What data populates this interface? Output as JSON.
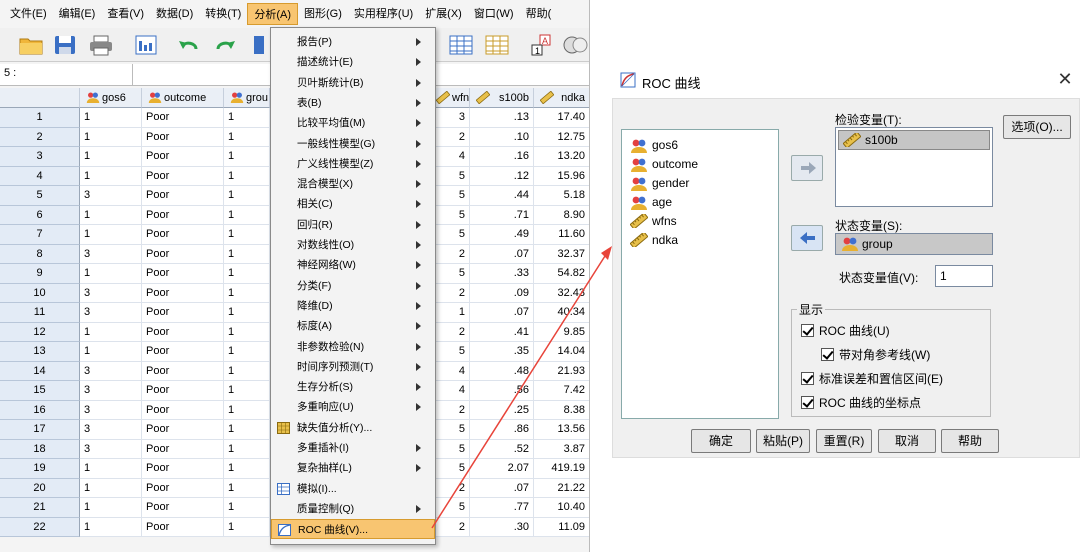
{
  "menubar": [
    "文件(E)",
    "编辑(E)",
    "查看(V)",
    "数据(D)",
    "转换(T)",
    "分析(A)",
    "图形(G)",
    "实用程序(U)",
    "扩展(X)",
    "窗口(W)",
    "帮助("
  ],
  "cellbar": {
    "ref": "5 :"
  },
  "grid": {
    "headers": [
      "gos6",
      "outcome",
      "grou",
      "wfns",
      "s100b",
      "ndka"
    ],
    "rows": [
      [
        "1",
        "1",
        "Poor",
        "1",
        "3",
        ".13",
        "17.40"
      ],
      [
        "2",
        "1",
        "Poor",
        "1",
        "2",
        ".10",
        "12.75"
      ],
      [
        "3",
        "1",
        "Poor",
        "1",
        "4",
        ".16",
        "13.20"
      ],
      [
        "4",
        "1",
        "Poor",
        "1",
        "5",
        ".12",
        "15.96"
      ],
      [
        "5",
        "3",
        "Poor",
        "1",
        "5",
        ".44",
        "5.18"
      ],
      [
        "6",
        "1",
        "Poor",
        "1",
        "5",
        ".71",
        "8.90"
      ],
      [
        "7",
        "1",
        "Poor",
        "1",
        "5",
        ".49",
        "11.60"
      ],
      [
        "8",
        "3",
        "Poor",
        "1",
        "2",
        ".07",
        "32.37"
      ],
      [
        "9",
        "1",
        "Poor",
        "1",
        "5",
        ".33",
        "54.82"
      ],
      [
        "10",
        "3",
        "Poor",
        "1",
        "2",
        ".09",
        "32.43"
      ],
      [
        "11",
        "3",
        "Poor",
        "1",
        "1",
        ".07",
        "40.34"
      ],
      [
        "12",
        "1",
        "Poor",
        "1",
        "2",
        ".41",
        "9.85"
      ],
      [
        "13",
        "1",
        "Poor",
        "1",
        "5",
        ".35",
        "14.04"
      ],
      [
        "14",
        "3",
        "Poor",
        "1",
        "4",
        ".48",
        "21.93"
      ],
      [
        "15",
        "3",
        "Poor",
        "1",
        "4",
        ".56",
        "7.42"
      ],
      [
        "16",
        "3",
        "Poor",
        "1",
        "2",
        ".25",
        "8.38"
      ],
      [
        "17",
        "3",
        "Poor",
        "1",
        "5",
        ".86",
        "13.56"
      ],
      [
        "18",
        "3",
        "Poor",
        "1",
        "5",
        ".52",
        "3.87"
      ],
      [
        "19",
        "1",
        "Poor",
        "1",
        "5",
        "2.07",
        "419.19"
      ],
      [
        "20",
        "1",
        "Poor",
        "1",
        "2",
        ".07",
        "21.22"
      ],
      [
        "21",
        "1",
        "Poor",
        "1",
        "5",
        ".77",
        "10.40"
      ],
      [
        "22",
        "1",
        "Poor",
        "1",
        "2",
        ".30",
        "11.09"
      ]
    ]
  },
  "menu": {
    "items": [
      {
        "label": "报告(P)",
        "sub": true
      },
      {
        "label": "描述统计(E)",
        "sub": true
      },
      {
        "label": "贝叶斯统计(B)",
        "sub": true
      },
      {
        "label": "表(B)",
        "sub": true
      },
      {
        "label": "比较平均值(M)",
        "sub": true
      },
      {
        "label": "一般线性模型(G)",
        "sub": true
      },
      {
        "label": "广义线性模型(Z)",
        "sub": true
      },
      {
        "label": "混合模型(X)",
        "sub": true
      },
      {
        "label": "相关(C)",
        "sub": true
      },
      {
        "label": "回归(R)",
        "sub": true
      },
      {
        "label": "对数线性(O)",
        "sub": true
      },
      {
        "label": "神经网络(W)",
        "sub": true
      },
      {
        "label": "分类(F)",
        "sub": true
      },
      {
        "label": "降维(D)",
        "sub": true
      },
      {
        "label": "标度(A)",
        "sub": true
      },
      {
        "label": "非参数检验(N)",
        "sub": true
      },
      {
        "label": "时间序列预测(T)",
        "sub": true
      },
      {
        "label": "生存分析(S)",
        "sub": true
      },
      {
        "label": "多重响应(U)",
        "sub": true
      },
      {
        "label": "缺失值分析(Y)...",
        "sub": false,
        "icon": "missing-value-icon"
      },
      {
        "label": "多重插补(I)",
        "sub": true
      },
      {
        "label": "复杂抽样(L)",
        "sub": true
      },
      {
        "label": "模拟(I)...",
        "sub": false,
        "icon": "simulation-icon"
      },
      {
        "label": "质量控制(Q)",
        "sub": true
      },
      {
        "label": "ROC 曲线(V)...",
        "sub": false,
        "icon": "roc-curve-icon",
        "highlight": true
      }
    ]
  },
  "dialog": {
    "title": "ROC 曲线",
    "close": "✕",
    "source_vars": [
      {
        "name": "gos6",
        "type": "nominal"
      },
      {
        "name": "outcome",
        "type": "nominal"
      },
      {
        "name": "gender",
        "type": "nominal"
      },
      {
        "name": "age",
        "type": "nominal"
      },
      {
        "name": "wfns",
        "type": "scale"
      },
      {
        "name": "ndka",
        "type": "scale"
      }
    ],
    "test_var_label": "检验变量(T):",
    "test_var": "s100b",
    "state_var_label": "状态变量(S):",
    "state_var": "group",
    "state_value_label": "状态变量值(V):",
    "state_value": "1",
    "options_btn": "选项(O)...",
    "display_label": "显示",
    "checks": [
      "ROC 曲线(U)",
      "带对角参考线(W)",
      "标准误差和置信区间(E)",
      "ROC 曲线的坐标点"
    ],
    "buttons": [
      "确定",
      "粘贴(P)",
      "重置(R)",
      "取消",
      "帮助"
    ],
    "colors": {
      "accent": "#f8c571",
      "arrow": "#e8443a"
    }
  }
}
